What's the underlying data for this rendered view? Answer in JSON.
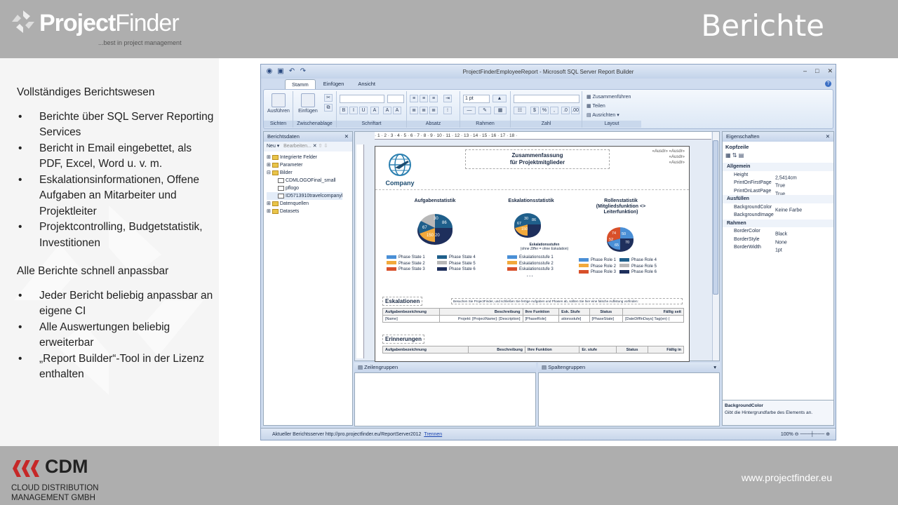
{
  "header": {
    "logo_brand_bold": "Project",
    "logo_brand_light": "Finder",
    "logo_tagline": "...best in project management",
    "page_title": "Berichte"
  },
  "left_panel": {
    "section1_title": "Vollständiges Berichtswesen",
    "section1_items": [
      "Berichte über SQL Server Reporting Services",
      "Bericht in Email eingebettet, als PDF, Excel,  Word u. v. m.",
      "Eskalationsinformationen, Offene Aufgaben an Mitarbeiter und Projektleiter",
      "Projektcontrolling, Budgetstatistik,  Investitionen"
    ],
    "section2_title": "Alle Berichte schnell anpassbar",
    "section2_items": [
      "Jeder Bericht beliebig anpassbar an eigene CI",
      "Alle Auswertungen beliebig erweiterbar",
      "„Report Builder“-Tool in der Lizenz enthalten"
    ]
  },
  "footer": {
    "company_short": "CDM",
    "company_line1": "CLOUD DISTRIBUTION",
    "company_line2": "MANAGEMENT GMBH",
    "url": "www.projectfinder.eu"
  },
  "app": {
    "window_title": "ProjectFinderEmployeeReport - Microsoft SQL Server Report Builder",
    "tabs": [
      "Stamm",
      "Einfügen",
      "Ansicht"
    ],
    "ribbon": {
      "run_label": "Ausführen",
      "paste_label": "Einfügen",
      "groups": [
        "Sichten",
        "Zwischenablage",
        "Schriftart",
        "Absatz",
        "Rahmen",
        "Zahl",
        "Layout"
      ],
      "border_size": "1 pt",
      "merge": "Zusammenführen",
      "split": "Teilen",
      "align": "Ausrichten"
    },
    "report_data": {
      "title": "Berichtsdaten",
      "new": "Neu",
      "edit": "Bearbeiten...",
      "tree": [
        "Integrierte Felder",
        "Parameter",
        "Bilder",
        "CDMLOGOFinal_small",
        "pflogo",
        "ID5713910travelcompanyl",
        "Datenquellen",
        "Datasets"
      ]
    },
    "ruler_marks": "· 1 · 2 · 3 · 4 · 5 · 6 · 7 · 8 · 9 · 10 · 11 · 12 · 13 · 14 · 15 · 16 · 17 · 18 ·",
    "report": {
      "company": "Company",
      "title_line1": "Zusammenfassung",
      "title_line2": "für Projektmitglieder",
      "ausdr": "«Ausdr» «Ausdr»",
      "ausdr2": "«Ausdr»",
      "ausdr3": "«Ausdr»",
      "chart1_title": "Aufgabenstatistik",
      "chart2_title": "Eskalationsstatistik",
      "chart3_title_l1": "Rollenstatistik",
      "chart3_title_l2": "(Mitgliedsfunktion <>",
      "chart3_title_l3": "Leiterfunktion)",
      "chart2_note_l1": "Eskalationsstufen",
      "chart2_note_l2": "(ohne Ziffer = ohne Eskalation)",
      "ellipsis": ". . .",
      "legend1": [
        "Phase State 1",
        "Phase State 4",
        "Phase State 2",
        "Phase State 5",
        "Phase State 3",
        "Phase State 6"
      ],
      "legend2": [
        "Eskalationsstufe 1",
        "Eskalationsstufe 2",
        "Eskalationsstufe 3"
      ],
      "legend3": [
        "Phase Role 1",
        "Phase Role 4",
        "Phase Role 2",
        "Phase Role 5",
        "Phase Role 3",
        "Phase Role 6"
      ],
      "pie1_labels": [
        "30",
        "86",
        "67",
        "150",
        "20",
        "9"
      ],
      "pie2_labels": [
        "30",
        "86",
        "67",
        "150",
        "9"
      ],
      "pie3_labels": [
        "74",
        "50",
        "52",
        "65",
        "70"
      ],
      "esc_heading": "Eskalationen",
      "esc_note": "Besuchen Sie ProjectFinder, und schließen Sie fertige Aufgaben und Phasen ab, sollten Sie hier eine falsche Auflistung vorfinden:",
      "esc_headers": [
        "Aufgabenbezeichnung",
        "Beschreibung",
        "Ihre Funktion",
        "Esk. Stufe",
        "Status",
        "Fällig seit"
      ],
      "esc_row": [
        "[Name]",
        "Projekt: [ProjectName]: [Description]",
        "[PhaseRole]",
        "ationsstufe]",
        "[PhaseState]",
        "[DateDiffInDays] Tag(en) ("
      ],
      "rem_heading": "Erinnerungen",
      "rem_headers": [
        "Aufgabenbezeichnung",
        "Beschreibung",
        "Ihre Funktion",
        "Er. stufe",
        "Status",
        "Fällig in"
      ]
    },
    "row_groups": "Zeilengruppen",
    "column_groups": "Spaltengruppen",
    "properties": {
      "title": "Eigenschaften",
      "section": "Kopfzeile",
      "rows": [
        {
          "cat": true,
          "name": "Allgemein",
          "value": ""
        },
        {
          "name": "Height",
          "value": "2,5414cm"
        },
        {
          "name": "PrintOnFirstPage",
          "value": "True"
        },
        {
          "name": "PrintOnLastPage",
          "value": "True"
        },
        {
          "cat": true,
          "name": "Ausfüllen",
          "value": ""
        },
        {
          "name": "BackgroundColor",
          "value": "Keine Farbe"
        },
        {
          "name": "BackgroundImage",
          "value": ""
        },
        {
          "cat": true,
          "name": "Rahmen",
          "value": ""
        },
        {
          "name": "BorderColor",
          "value": "Black"
        },
        {
          "name": "BorderStyle",
          "value": "None"
        },
        {
          "name": "BorderWidth",
          "value": "1pt"
        }
      ],
      "desc_title": "BackgroundColor",
      "desc_text": "Gibt die Hintergrundfarbe des Elements an."
    },
    "status": {
      "server_label": "Aktueller Berichtsserver http://pro.projectfinder.eu/ReportServer2012",
      "disconnect": "Trennen",
      "zoom": "100%"
    }
  },
  "colors": {
    "topbar": "#aeaeae",
    "series": [
      "#4a8fd6",
      "#f2a93b",
      "#d8502a",
      "#1f5f8b",
      "#b8b8b8",
      "#1e2f5c"
    ]
  }
}
